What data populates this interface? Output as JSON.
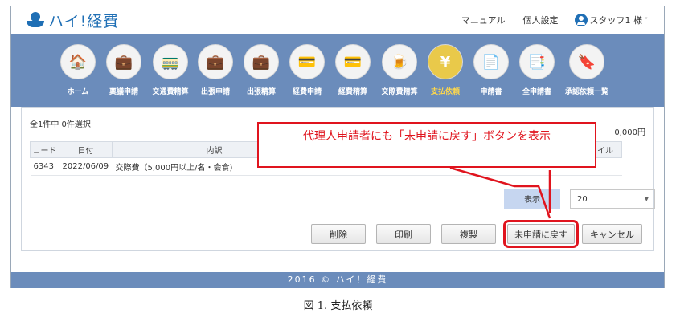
{
  "header": {
    "logo_text": "ハイ!経費",
    "manual_label": "マニュアル",
    "settings_label": "個人設定",
    "user_label": "スタッフ1 様"
  },
  "nav": {
    "items": [
      {
        "label": "ホーム",
        "icon": "home-icon",
        "glyph": "🏠"
      },
      {
        "label": "稟議申請",
        "icon": "briefcase-doc-icon",
        "glyph": "💼"
      },
      {
        "label": "交通費精算",
        "icon": "train-icon",
        "glyph": "🚃"
      },
      {
        "label": "出張申請",
        "icon": "briefcase-doc-icon",
        "glyph": "💼"
      },
      {
        "label": "出張精算",
        "icon": "briefcase-money-icon",
        "glyph": "💼"
      },
      {
        "label": "経費申請",
        "icon": "card-doc-icon",
        "glyph": "💳"
      },
      {
        "label": "経費精算",
        "icon": "card-money-icon",
        "glyph": "💳"
      },
      {
        "label": "交際費精算",
        "icon": "drink-money-icon",
        "glyph": "🍺"
      },
      {
        "label": "支払依頼",
        "icon": "yen-purse-icon",
        "glyph": "¥",
        "active": true
      },
      {
        "label": "申請書",
        "icon": "document-icon",
        "glyph": "📄"
      },
      {
        "label": "全申請書",
        "icon": "documents-icon",
        "glyph": "📑"
      },
      {
        "label": "承認依頼一覧",
        "icon": "stamp-icon",
        "glyph": "🔖"
      }
    ]
  },
  "list": {
    "count_text": "全1件中 0件選択",
    "total_text": "0,000円",
    "columns": [
      "コード",
      "日付",
      "内訳",
      "ファイル"
    ],
    "rows": [
      {
        "code": "6343",
        "date": "2022/06/09",
        "item": "交際費（5,000円以上/名・会食)"
      }
    ],
    "pager_label": "表示",
    "page_size": "20"
  },
  "buttons": {
    "delete": "削除",
    "print": "印刷",
    "copy": "複製",
    "revert": "未申請に戻す",
    "cancel": "キャンセル"
  },
  "callout": {
    "text": "代理人申請者にも「未申請に戻す」ボタンを表示"
  },
  "footer": {
    "text": "2016 © ハイ！経費"
  },
  "caption": "図 1. 支払依頼",
  "colors": {
    "accent": "#1f6fb5",
    "nav_bg": "#6b8cbb",
    "highlight": "#e0141e"
  }
}
